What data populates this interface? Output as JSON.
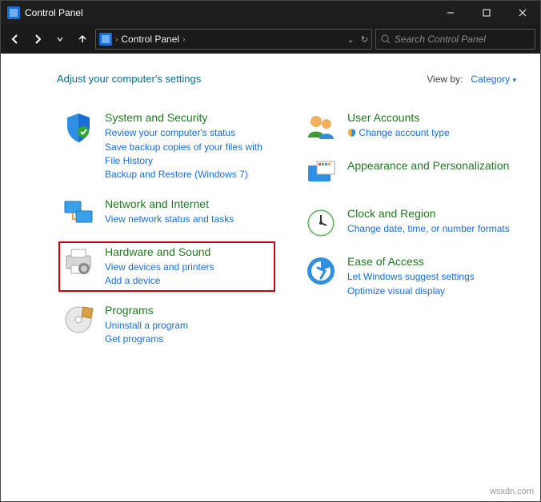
{
  "titlebar": {
    "title": "Control Panel"
  },
  "nav": {
    "breadcrumb": "Control Panel",
    "search_placeholder": "Search Control Panel"
  },
  "header": {
    "heading": "Adjust your computer's settings",
    "viewby_label": "View by:",
    "viewby_value": "Category"
  },
  "left": {
    "system": {
      "title": "System and Security",
      "l1": "Review your computer's status",
      "l2": "Save backup copies of your files with File History",
      "l3": "Backup and Restore (Windows 7)"
    },
    "network": {
      "title": "Network and Internet",
      "l1": "View network status and tasks"
    },
    "hardware": {
      "title": "Hardware and Sound",
      "l1": "View devices and printers",
      "l2": "Add a device"
    },
    "programs": {
      "title": "Programs",
      "l1": "Uninstall a program",
      "l2": "Get programs"
    }
  },
  "right": {
    "users": {
      "title": "User Accounts",
      "l1": "Change account type"
    },
    "appearance": {
      "title": "Appearance and Personalization"
    },
    "clock": {
      "title": "Clock and Region",
      "l1": "Change date, time, or number formats"
    },
    "ease": {
      "title": "Ease of Access",
      "l1": "Let Windows suggest settings",
      "l2": "Optimize visual display"
    }
  },
  "watermark": "wsxdn.com"
}
